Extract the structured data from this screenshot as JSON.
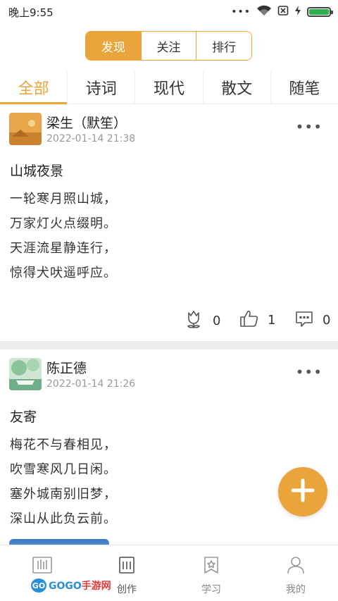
{
  "status_bar": {
    "time": "晚上9:55",
    "dots": "•••",
    "battery_level": 1.0
  },
  "top_tabs": [
    {
      "label": "发现",
      "active": true
    },
    {
      "label": "关注",
      "active": false
    },
    {
      "label": "排行",
      "active": false
    }
  ],
  "category_tabs": [
    {
      "label": "全部",
      "active": true
    },
    {
      "label": "诗词",
      "active": false
    },
    {
      "label": "现代",
      "active": false
    },
    {
      "label": "散文",
      "active": false
    },
    {
      "label": "随笔",
      "active": false
    }
  ],
  "posts": [
    {
      "author": "梁生（默笙）",
      "time": "2022-01-14 21:38",
      "title": "山城夜景",
      "lines": [
        "一轮寒月照山城，",
        "万家灯火点缀明。",
        "天涯流星静连行，",
        "惊得犬吠遥呼应。"
      ],
      "flower_count": "0",
      "like_count": "1",
      "comment_count": "0"
    },
    {
      "author": "陈正德",
      "time": "2022-01-14 21:26",
      "title": "友寄",
      "lines": [
        "梅花不与春相见，",
        "吹雪寒风几日闲。",
        "塞外城南别旧梦，",
        "深山从此负云前。"
      ]
    }
  ],
  "bottom_nav": [
    {
      "label": "",
      "icon": "library-icon",
      "active": false
    },
    {
      "label": "创作",
      "icon": "compose-icon",
      "active": true
    },
    {
      "label": "学习",
      "icon": "bookmark-star-icon",
      "active": false
    },
    {
      "label": "我的",
      "icon": "person-icon",
      "active": false
    }
  ],
  "watermark": {
    "badge": "GO",
    "text_a": "GOGO",
    "text_b": "手游网"
  },
  "colors": {
    "accent": "#e9a53c",
    "separator": "#ececec"
  }
}
